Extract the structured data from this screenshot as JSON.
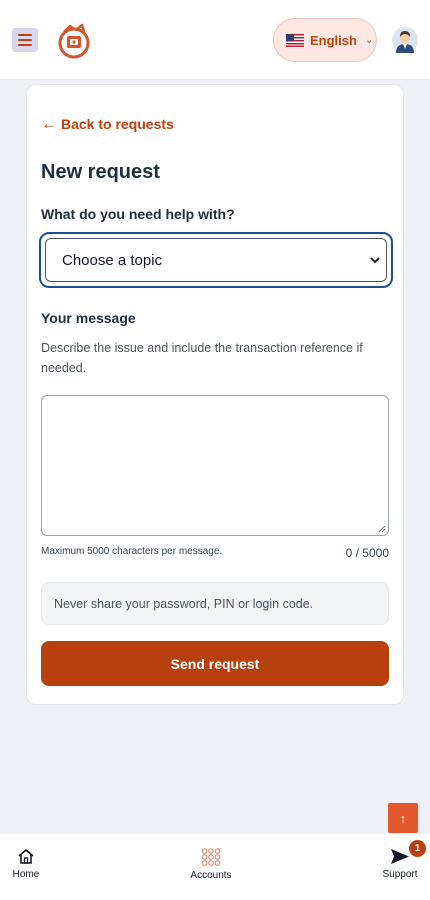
{
  "header": {
    "menu_icon": "hamburger-icon",
    "logo_icon": "brand-logo",
    "language": {
      "label": "English",
      "flag_icon": "us-flag-icon",
      "chevron_icon": "chevron-down-icon"
    },
    "avatar_icon": "user-avatar-icon"
  },
  "form": {
    "back_link": {
      "arrow": "←",
      "label": "Back to requests"
    },
    "title": "New request",
    "topic": {
      "label": "What do you need help with?",
      "value": "Choose a topic"
    },
    "message": {
      "label": "Your message",
      "help": "Describe the issue and include the transaction reference if needed.",
      "value": "",
      "max_note": "Maximum 5000 characters per message.",
      "char_count": "0 / 5000"
    },
    "safety_note": "Never share your password, PIN or login code.",
    "submit_label": "Send request"
  },
  "scroll_top": {
    "glyph": "↑",
    "icon": "arrow-up-icon"
  },
  "bottom_nav": {
    "items": [
      {
        "label": "Home",
        "icon": "home-icon"
      },
      {
        "label": "Accounts",
        "icon": "accounts-grid-icon"
      },
      {
        "label": "Support",
        "icon": "send-icon",
        "badge": "1"
      }
    ]
  },
  "colors": {
    "accent": "#c2410c",
    "button": "#b8400f",
    "focus_border": "#1e4e8c",
    "background": "#eef0f6"
  }
}
